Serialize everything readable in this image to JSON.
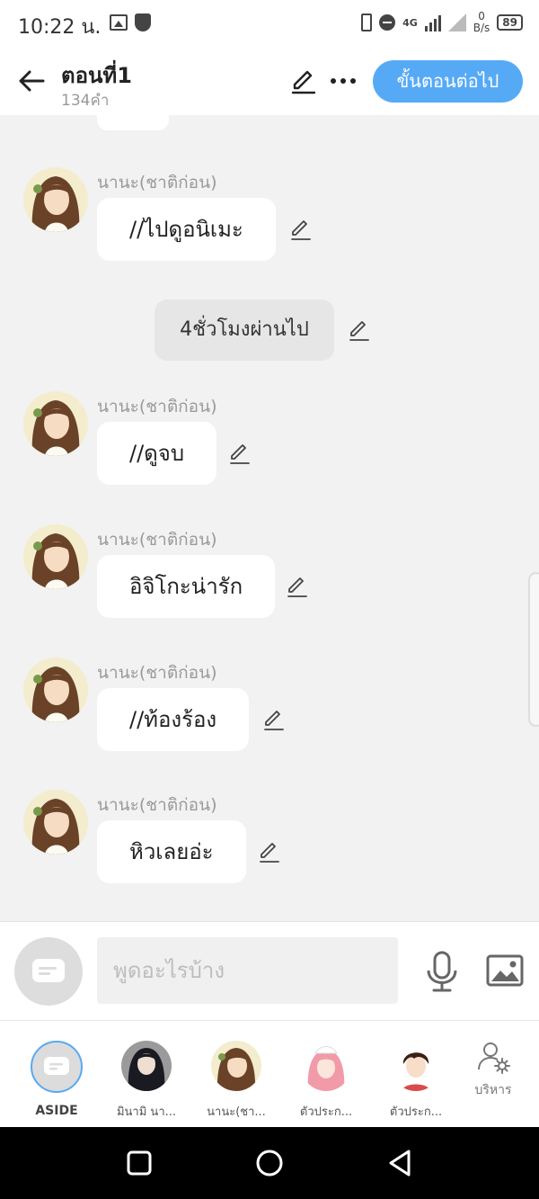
{
  "status_bar": {
    "time": "10:22 น.",
    "network": "4G",
    "speed_value": "0",
    "speed_unit": "B/s",
    "battery": "89"
  },
  "header": {
    "title": "ตอนที่1",
    "word_count": "134คำ",
    "next_button_label": "ขั้นตอนต่อไป"
  },
  "messages": [
    {
      "sender": "นานะ(ชาติก่อน)",
      "text": "//ไปดูอนิเมะ"
    },
    {
      "sender": "นานะ(ชาติก่อน)",
      "text": "//ดูจบ"
    },
    {
      "sender": "นานะ(ชาติก่อน)",
      "text": "อิจิโกะน่ารัก"
    },
    {
      "sender": "นานะ(ชาติก่อน)",
      "text": "//ท้องร้อง"
    },
    {
      "sender": "นานะ(ชาติก่อน)",
      "text": "หิวเลยอ่ะ"
    }
  ],
  "narration": "4ชั่วโมงผ่านไป",
  "input": {
    "placeholder": "พูดอะไรบ้าง"
  },
  "characters": [
    {
      "label": "ASIDE"
    },
    {
      "label": "มินามิ นา..."
    },
    {
      "label": "นานะ(ชา..."
    },
    {
      "label": "ตัวประก..."
    },
    {
      "label": "ตัวประก..."
    },
    {
      "label": "บริหาร"
    }
  ],
  "colors": {
    "accent": "#56aaf5",
    "background": "#f2f2f2",
    "bubble": "#ffffff"
  }
}
